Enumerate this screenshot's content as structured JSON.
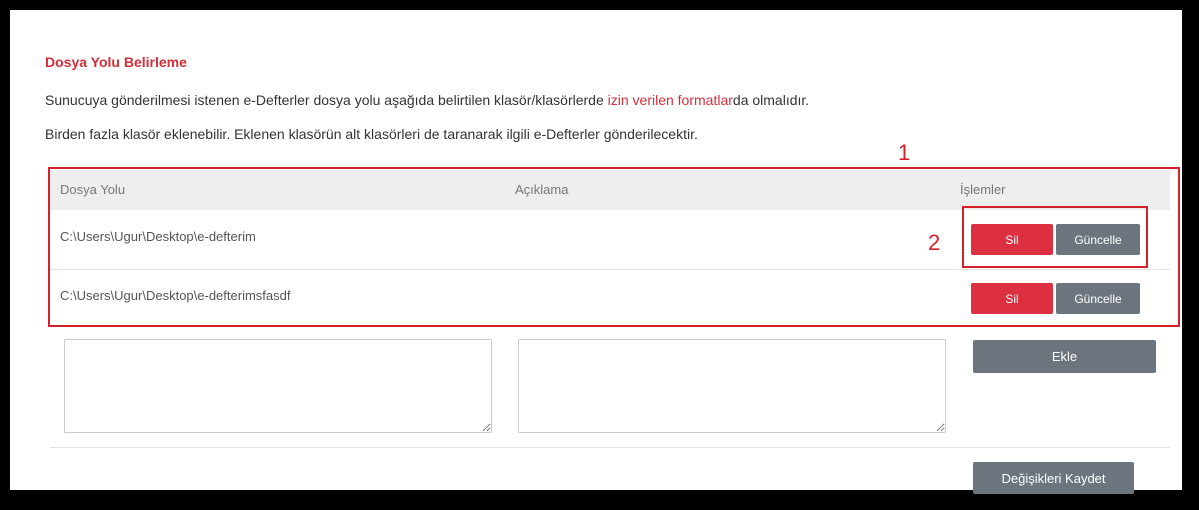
{
  "section": {
    "title": "Dosya Yolu Belirleme",
    "info1_before": "Sunucuya gönderilmesi istenen e-Defterler dosya yolu aşağıda belirtilen klasör/klasörlerde ",
    "info1_link": "izin verilen formatlar",
    "info1_after": "da olmalıdır.",
    "info2": "Birden fazla klasör eklenebilir. Eklenen klasörün alt klasörleri de taranarak ilgili e-Defterler gönderilecektir."
  },
  "table": {
    "headers": {
      "path": "Dosya Yolu",
      "desc": "Açıklama",
      "ops": "İşlemler"
    },
    "rows": [
      {
        "path": "C:\\Users\\Ugur\\Desktop\\e-defterim",
        "desc": "",
        "delete_label": "Sil",
        "update_label": "Güncelle"
      },
      {
        "path": "C:\\Users\\Ugur\\Desktop\\e-defterimsfasdf",
        "desc": "",
        "delete_label": "Sil",
        "update_label": "Güncelle"
      }
    ]
  },
  "form": {
    "path_value": "",
    "desc_value": "",
    "add_label": "Ekle",
    "save_label": "Değişikleri Kaydet"
  },
  "annotations": {
    "callout_1": "1",
    "callout_2": "2"
  },
  "colors": {
    "accent_red": "#d32f3a",
    "button_gray": "#6c757d",
    "delete_red": "#dc2f3f"
  }
}
